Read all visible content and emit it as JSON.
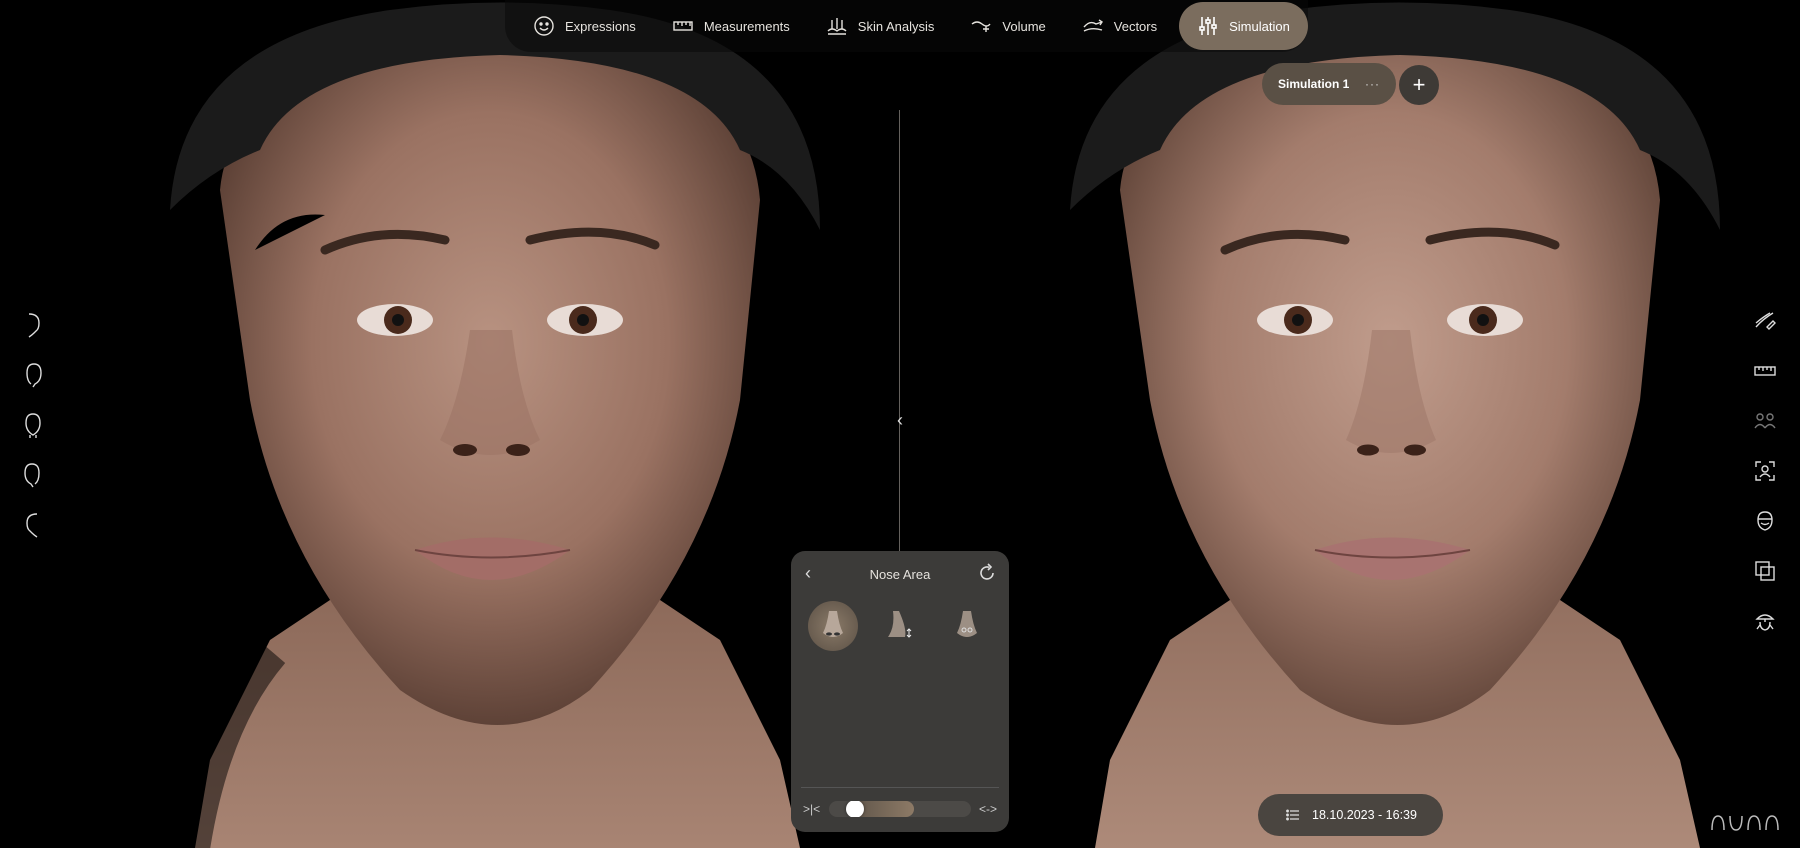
{
  "app": {
    "logo": "AURA"
  },
  "nav": {
    "items": [
      {
        "label": "Expressions",
        "icon": "smiley-icon"
      },
      {
        "label": "Measurements",
        "icon": "ruler-icon"
      },
      {
        "label": "Skin Analysis",
        "icon": "skin-analysis-icon"
      },
      {
        "label": "Volume",
        "icon": "volume-icon"
      },
      {
        "label": "Vectors",
        "icon": "vectors-icon"
      },
      {
        "label": "Simulation",
        "icon": "sliders-icon",
        "active": true
      }
    ]
  },
  "simulation": {
    "tab_label": "Simulation 1",
    "more_label": "···",
    "add_label": "+"
  },
  "left_tools": [
    "profile-right-view-icon",
    "three-quarter-right-view-icon",
    "front-view-icon",
    "three-quarter-left-view-icon",
    "profile-left-view-icon"
  ],
  "right_tools": [
    "annotate-icon",
    "ruler-icon",
    "compare-people-icon",
    "focus-frame-icon",
    "face-mask-icon",
    "layers-icon",
    "lighting-icon"
  ],
  "panel": {
    "title": "Nose Area",
    "options": [
      {
        "name": "nose-front-option",
        "active": true
      },
      {
        "name": "nose-profile-option",
        "active": false
      },
      {
        "name": "nose-tip-option",
        "active": false
      }
    ],
    "slider": {
      "value": 0.15,
      "fill_to": 0.6
    }
  },
  "session": {
    "date": "18.10.2023 - 16:39"
  },
  "colors": {
    "accent": "#7b6d5e",
    "panel_bg": "#3c3b39",
    "background": "#000000"
  }
}
